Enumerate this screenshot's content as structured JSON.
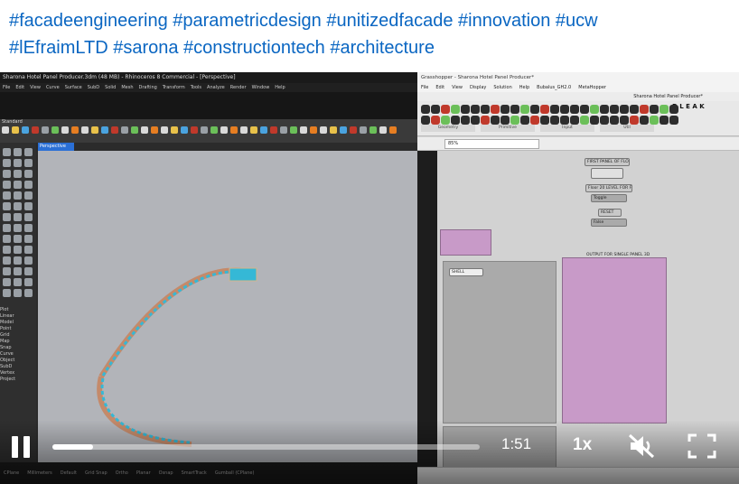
{
  "post": {
    "hashtags_line1": "#facadeengineering #parametricdesign #unitizedfacade #innovation #ucw",
    "hashtags_line2": "#lEfraimLTD #sarona #constructiontech #architecture"
  },
  "rhino": {
    "window_title": "Sharona Hotel Panel Producer.3dm (48 MB) - Rhinoceros 8 Commercial - [Perspective]",
    "menu": [
      "File",
      "Edit",
      "View",
      "Curve",
      "Surface",
      "SubD",
      "Solid",
      "Mesh",
      "Drafting",
      "Transform",
      "Tools",
      "Analyze",
      "Render",
      "Window",
      "Help"
    ],
    "toolbar_tab": "Standard",
    "viewport_tab": "Perspective",
    "props": [
      "Plot",
      "Linear",
      "Model",
      "Point",
      "Grid",
      "Map",
      "Snap",
      "Curve",
      "Object",
      "SubD",
      "Vertex",
      "Project"
    ],
    "status": [
      "CPlane",
      "Millimeters",
      "Default",
      "Grid Snap",
      "Ortho",
      "Planar",
      "Osnap",
      "SmartTrack",
      "Gumball (CPlane)"
    ]
  },
  "grasshopper": {
    "window_title": "Grasshopper - Sharona Hotel Panel Producer*",
    "menu": [
      "File",
      "Edit",
      "View",
      "Display",
      "Solution",
      "Help",
      "Bubalus_GH2.0",
      "MetaHopper"
    ],
    "doc_name": "Sharona Hotel Panel Producer*",
    "ribbon_letters": "D L E A K",
    "categories": [
      "Geometry",
      "Primitive",
      "Input",
      "Util"
    ],
    "zoom": "85%",
    "nodes": {
      "first_panel": "FIRST PANEL OF FLOOR",
      "floor_label": "Floor 20 LEVEL FOR FLOOR",
      "toggle_a": "Toggle",
      "false_a": "False",
      "reset": "RESET",
      "output": "OUTPUT FOR SINGLE PANEL 3D",
      "shell": "SHELL"
    }
  },
  "player": {
    "time": "1:51",
    "speed": "1x",
    "progress": 0.095,
    "icons": [
      "pause-icon",
      "mute-icon",
      "fullscreen-icon"
    ]
  }
}
